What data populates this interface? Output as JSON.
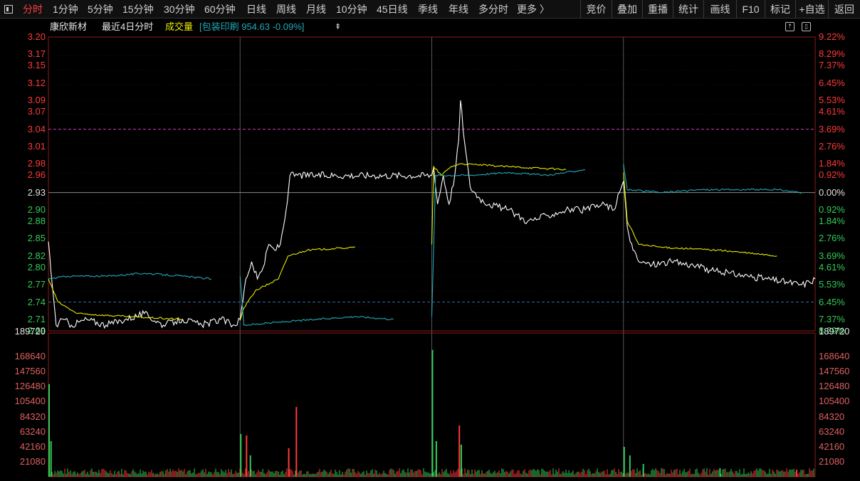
{
  "toolbar": {
    "periods": [
      "分时",
      "1分钟",
      "5分钟",
      "15分钟",
      "30分钟",
      "60分钟",
      "日线",
      "周线",
      "月线",
      "10分钟",
      "45日线",
      "季线",
      "年线",
      "多分时",
      "更多 〉"
    ],
    "active_period": "分时",
    "tools": [
      "竞价",
      "叠加",
      "重播",
      "统计",
      "画线",
      "F10",
      "标记",
      "+自选",
      "返回"
    ]
  },
  "info": {
    "stock_name": "康欣新材",
    "view_label": "最近4日分时",
    "volume_label": "成交量",
    "overlay_text": "[包装印刷 954.63  -0.09%]"
  },
  "colors": {
    "up": "#ff3a3a",
    "down": "#33cc55",
    "neutral": "#e0e0e0",
    "avg_line": "#e8e800",
    "index_line": "#22aab8",
    "price_line": "#ffffff",
    "ref_line": "#c040c0"
  },
  "axis": {
    "price_ticks": [
      "3.20",
      "3.17",
      "3.15",
      "3.12",
      "3.09",
      "3.07",
      "3.04",
      "3.01",
      "2.98",
      "2.96",
      "2.93",
      "2.90",
      "2.88",
      "2.85",
      "2.82",
      "2.80",
      "2.77",
      "2.74",
      "2.71",
      "2.69"
    ],
    "pct_ticks": [
      "9.22%",
      "8.29%",
      "7.37%",
      "6.45%",
      "5.53%",
      "4.61%",
      "3.69%",
      "2.76%",
      "1.84%",
      "0.92%",
      "0.00%",
      "0.92%",
      "1.84%",
      "2.76%",
      "3.69%",
      "4.61%",
      "5.53%",
      "6.45%",
      "7.37%",
      "8.29%"
    ],
    "volume_ticks": [
      "189720",
      "168640",
      "147560",
      "126480",
      "105400",
      "84320",
      "63240",
      "42160",
      "21080"
    ],
    "prev_close": 2.93,
    "price_max": 3.2,
    "price_min": 2.69,
    "volume_max": 189720,
    "ref_high": 3.04,
    "ref_low": 2.74
  },
  "chart_data": {
    "type": "line",
    "days": 4,
    "series": [
      {
        "key": "price",
        "color": "#ffffff",
        "points": [
          [
            0,
            2.845
          ],
          [
            0.02,
            2.77
          ],
          [
            0.04,
            2.7
          ],
          [
            0.08,
            2.71
          ],
          [
            0.12,
            2.7
          ],
          [
            0.2,
            2.71
          ],
          [
            0.3,
            2.7
          ],
          [
            0.4,
            2.71
          ],
          [
            0.5,
            2.72
          ],
          [
            0.6,
            2.7
          ],
          [
            0.7,
            2.71
          ],
          [
            0.8,
            2.7
          ],
          [
            0.9,
            2.71
          ],
          [
            0.97,
            2.7
          ],
          [
            1.0,
            2.71
          ],
          [
            1.03,
            2.78
          ],
          [
            1.06,
            2.81
          ],
          [
            1.09,
            2.78
          ],
          [
            1.12,
            2.8
          ],
          [
            1.15,
            2.84
          ],
          [
            1.18,
            2.83
          ],
          [
            1.21,
            2.84
          ],
          [
            1.24,
            2.9
          ],
          [
            1.26,
            2.96
          ],
          [
            1.3,
            2.96
          ],
          [
            1.5,
            2.96
          ],
          [
            1.7,
            2.96
          ],
          [
            2.0,
            2.96
          ],
          [
            2.01,
            2.975
          ],
          [
            2.03,
            2.91
          ],
          [
            2.06,
            2.96
          ],
          [
            2.09,
            2.91
          ],
          [
            2.12,
            2.96
          ],
          [
            2.14,
            3.02
          ],
          [
            2.15,
            3.09
          ],
          [
            2.17,
            3.02
          ],
          [
            2.2,
            2.94
          ],
          [
            2.25,
            2.92
          ],
          [
            2.3,
            2.91
          ],
          [
            2.4,
            2.9
          ],
          [
            2.5,
            2.88
          ],
          [
            2.6,
            2.89
          ],
          [
            2.7,
            2.9
          ],
          [
            2.8,
            2.9
          ],
          [
            2.9,
            2.91
          ],
          [
            2.95,
            2.9
          ],
          [
            3.0,
            2.95
          ],
          [
            3.02,
            2.87
          ],
          [
            3.05,
            2.83
          ],
          [
            3.08,
            2.81
          ],
          [
            3.15,
            2.805
          ],
          [
            3.25,
            2.81
          ],
          [
            3.35,
            2.805
          ],
          [
            3.45,
            2.795
          ],
          [
            3.55,
            2.79
          ],
          [
            3.65,
            2.785
          ],
          [
            3.75,
            2.78
          ],
          [
            3.85,
            2.775
          ],
          [
            3.93,
            2.77
          ],
          [
            3.97,
            2.775
          ],
          [
            4.0,
            2.78
          ]
        ]
      },
      {
        "key": "avg",
        "color": "#e8e800",
        "points": [
          [
            0,
            2.78
          ],
          [
            0.05,
            2.74
          ],
          [
            0.15,
            2.72
          ],
          [
            0.4,
            2.715
          ],
          [
            0.7,
            2.71
          ],
          [
            1.0,
            2.708
          ],
          [
            1.02,
            2.73
          ],
          [
            1.08,
            2.76
          ],
          [
            1.2,
            2.78
          ],
          [
            1.25,
            2.82
          ],
          [
            1.35,
            2.83
          ],
          [
            1.6,
            2.835
          ],
          [
            2.0,
            2.84
          ],
          [
            2.01,
            2.975
          ],
          [
            2.05,
            2.96
          ],
          [
            2.1,
            2.975
          ],
          [
            2.15,
            2.98
          ],
          [
            2.4,
            2.975
          ],
          [
            2.7,
            2.97
          ],
          [
            3.0,
            2.965
          ],
          [
            3.02,
            2.88
          ],
          [
            3.08,
            2.84
          ],
          [
            3.2,
            2.835
          ],
          [
            3.5,
            2.83
          ],
          [
            3.8,
            2.82
          ],
          [
            4.0,
            2.815
          ]
        ]
      },
      {
        "key": "index",
        "color": "#22aab8",
        "points": [
          [
            0,
            2.78
          ],
          [
            0.1,
            2.785
          ],
          [
            0.3,
            2.785
          ],
          [
            0.5,
            2.79
          ],
          [
            0.7,
            2.785
          ],
          [
            0.85,
            2.78
          ],
          [
            1.0,
            2.785
          ],
          [
            1.02,
            2.7
          ],
          [
            1.2,
            2.705
          ],
          [
            1.4,
            2.71
          ],
          [
            1.6,
            2.715
          ],
          [
            1.8,
            2.71
          ],
          [
            2.0,
            2.715
          ],
          [
            2.02,
            2.96
          ],
          [
            2.2,
            2.96
          ],
          [
            2.4,
            2.965
          ],
          [
            2.6,
            2.96
          ],
          [
            2.8,
            2.97
          ],
          [
            3.0,
            2.98
          ],
          [
            3.02,
            2.935
          ],
          [
            3.2,
            2.93
          ],
          [
            3.4,
            2.935
          ],
          [
            3.6,
            2.935
          ],
          [
            3.8,
            2.935
          ],
          [
            3.93,
            2.93
          ],
          [
            4.0,
            2.93
          ]
        ]
      }
    ],
    "volume_spikes": [
      [
        0.0,
        130000,
        "d"
      ],
      [
        0.01,
        50000,
        "d"
      ],
      [
        1.0,
        60000,
        "d"
      ],
      [
        1.03,
        58000,
        "u"
      ],
      [
        1.05,
        30000,
        "d"
      ],
      [
        1.25,
        40000,
        "u"
      ],
      [
        1.29,
        98000,
        "u"
      ],
      [
        2.0,
        178000,
        "d"
      ],
      [
        2.02,
        50000,
        "d"
      ],
      [
        2.14,
        72000,
        "u"
      ],
      [
        2.15,
        45000,
        "d"
      ],
      [
        3.0,
        42000,
        "d"
      ],
      [
        3.03,
        30000,
        "d"
      ],
      [
        3.1,
        18000,
        "d"
      ],
      [
        3.5,
        12000,
        "d"
      ],
      [
        3.9,
        10000,
        "u"
      ]
    ]
  }
}
